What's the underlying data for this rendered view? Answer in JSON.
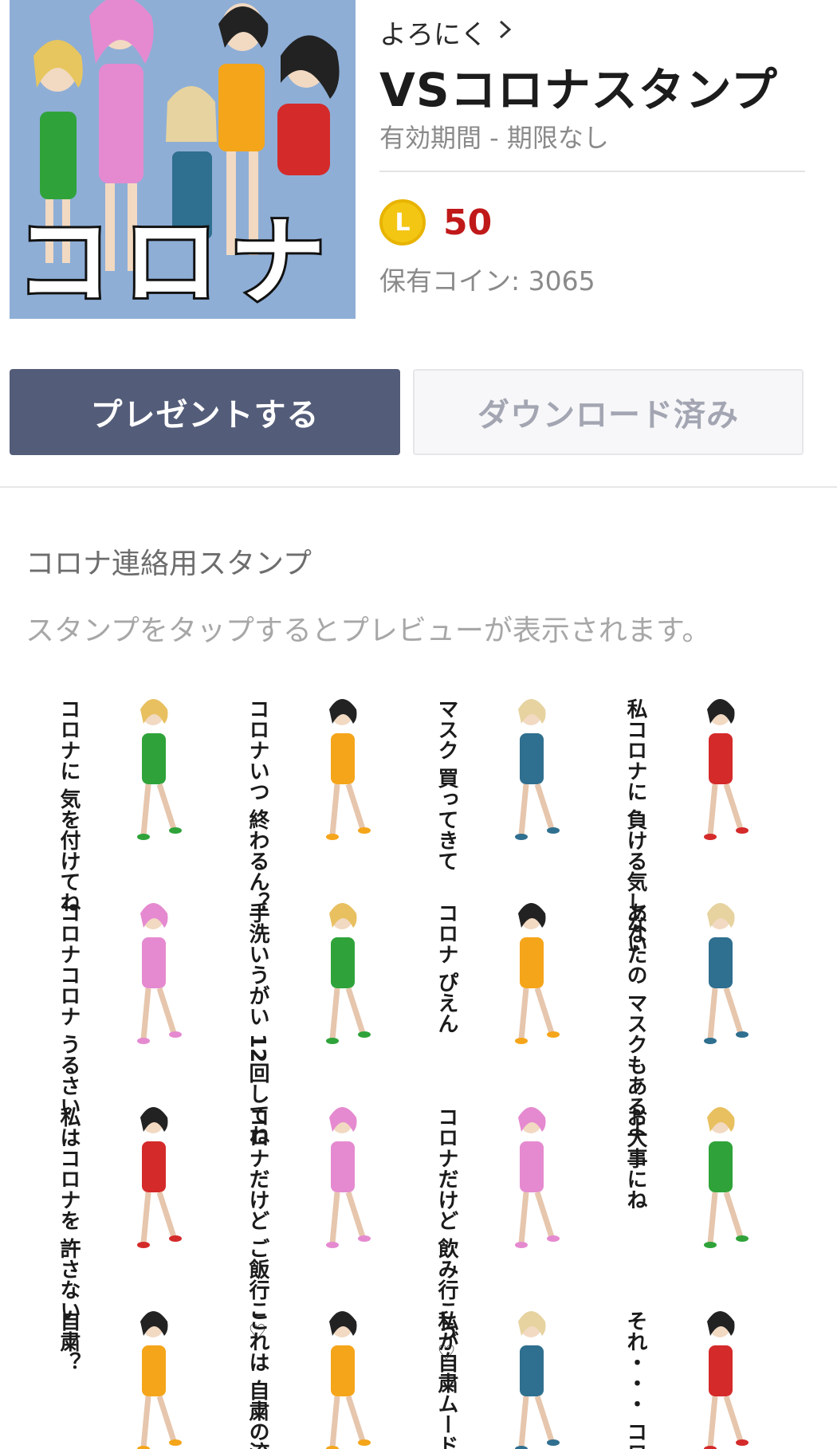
{
  "header": {
    "author": "よろにく",
    "author_chevron": "chevron-right-icon",
    "title": "VSコロナスタンプ",
    "validity": "有効期間 - 期限なし",
    "price": {
      "coin_label": "L",
      "value": "50",
      "owned": "保有コイン: 3065"
    },
    "cover_text": "コロナ"
  },
  "actions": {
    "present_label": "プレゼントする",
    "downloaded_label": "ダウンロード済み"
  },
  "content": {
    "description": "コロナ連絡用スタンプ",
    "hint": "スタンプをタップするとプレビューが表示されます。"
  },
  "colors": {
    "present_button": "#535c78",
    "price": "#c01919",
    "coin": "#f3c614",
    "cover_background": "#8eaed6"
  },
  "stickers": [
    {
      "caption": "コロナに 気を付けてね",
      "dress": "#2fa33a",
      "hair": "#e8c060"
    },
    {
      "caption": "コロナいつ 終わるん？",
      "dress": "#f5a51a",
      "hair": "#222222"
    },
    {
      "caption": "マスク 買ってきて",
      "dress": "#2f6f8f",
      "hair": "#e6d3a0"
    },
    {
      "caption": "私コロナに 負ける気しない",
      "dress": "#d42a2a",
      "hair": "#222222"
    },
    {
      "caption": "コロナコロナ うるさい",
      "dress": "#e58ad0",
      "hair": "#e58ad0"
    },
    {
      "caption": "手洗いうがい 12回してね",
      "dress": "#2fa33a",
      "hair": "#e8c060"
    },
    {
      "caption": "コロナ ぴえん",
      "dress": "#f5a51a",
      "hair": "#222222"
    },
    {
      "caption": "あなたの マスクもあるよ",
      "dress": "#2f6f8f",
      "hair": "#e6d3a0"
    },
    {
      "caption": "私はコロナを 許さない",
      "dress": "#d42a2a",
      "hair": "#222222"
    },
    {
      "caption": "コロナだけど ご飯行こ♡",
      "dress": "#e58ad0",
      "hair": "#e58ad0"
    },
    {
      "caption": "コロナだけど 飲み行こう♡",
      "dress": "#e58ad0",
      "hair": "#e58ad0"
    },
    {
      "caption": "お大事にね",
      "dress": "#2fa33a",
      "hair": "#e8c060"
    },
    {
      "caption": "自粛？",
      "dress": "#f5a51a",
      "hair": "#222222"
    },
    {
      "caption": "これは 自粛の流れ？",
      "dress": "#f5a51a",
      "hair": "#222222"
    },
    {
      "caption": "私が自粛ムード をぶっ壊す",
      "dress": "#2f6f8f",
      "hair": "#e6d3a0"
    },
    {
      "caption": "それ・・・ コロナじゃない？",
      "dress": "#d42a2a",
      "hair": "#222222"
    }
  ]
}
